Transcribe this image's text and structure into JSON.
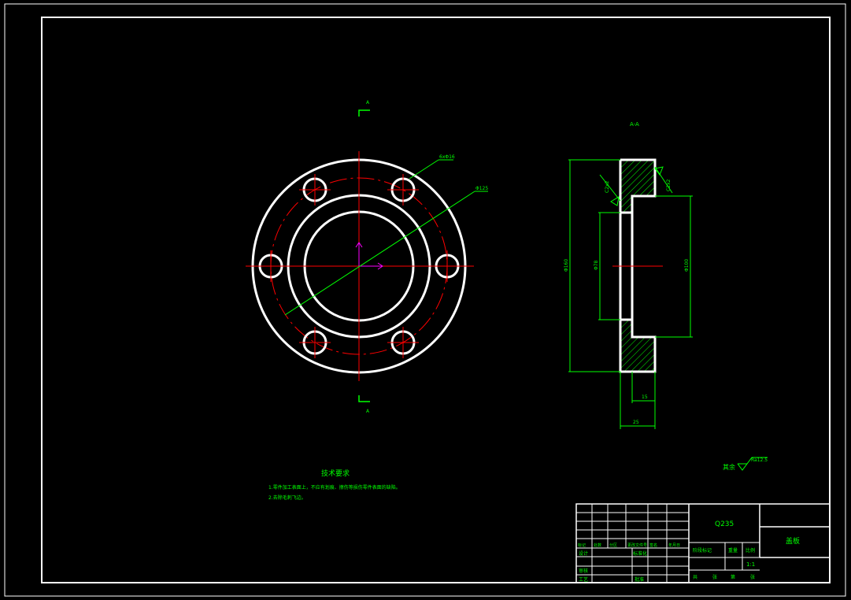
{
  "views": {
    "section_label": "A-A",
    "cut_label_top": "A",
    "cut_label_bottom": "A"
  },
  "dimensions": {
    "holes": "6xΦ16",
    "bolt_circle": "Φ125",
    "chamfer_left": "C2x2",
    "chamfer_right": "C2x2",
    "outer_diameter": "Φ160",
    "bore_diameter": "Φ78",
    "step_diameter": "Φ100",
    "step_depth": "15",
    "total_thickness": "25"
  },
  "roughness": {
    "label": "其余",
    "value": "Ra12.5"
  },
  "technical_requirements": {
    "title": "技术要求",
    "items": [
      "1.零件加工表面上，不应有划痕、擦伤等损伤零件表面的缺陷。",
      "2.去除毛刺飞边。"
    ]
  },
  "title_block": {
    "material": "Q235",
    "part_name": "盖板",
    "row_labels_left": [
      "标记",
      "处数",
      "分区",
      "更改文件号",
      "签名",
      "年月日"
    ],
    "designer_label": "设计",
    "standard_label": "标准化",
    "review_label": "审核",
    "process_label": "工艺",
    "approve_label": "批准",
    "stage_label": "阶段标记",
    "weight_label": "重量",
    "scale_label": "比例",
    "scale_value": "1:1",
    "sheets_text": [
      "共",
      "张",
      "第",
      "张"
    ]
  },
  "colors": {
    "outline": "#ffffff",
    "dimension": "#00ff00",
    "centerline": "#ff0000",
    "hatch": "#00ff00",
    "axis": "#ff00ff"
  }
}
